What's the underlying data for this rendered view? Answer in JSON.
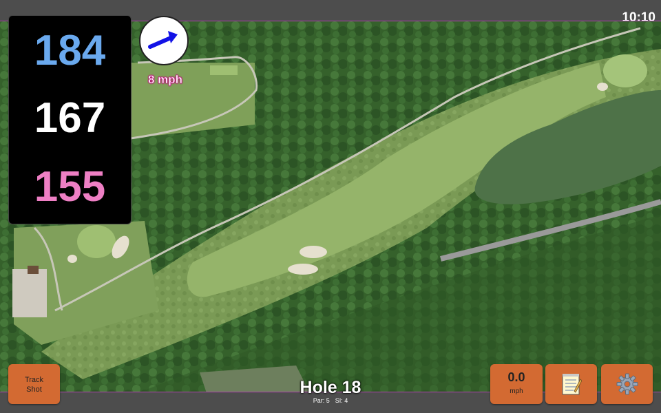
{
  "status_bar": {
    "time": "10:10"
  },
  "distances": {
    "back": "184",
    "middle": "167",
    "front": "155"
  },
  "wind": {
    "speed_label": "8 mph",
    "direction_icon": "wind-direction-arrow-icon"
  },
  "buttons": {
    "track_shot_line1": "Track",
    "track_shot_line2": "Shot",
    "speed_value": "0.0",
    "speed_unit": "mph",
    "notes_icon": "notepad-icon",
    "settings_icon": "gear-icon"
  },
  "hole": {
    "title": "Hole 18",
    "par": "Par: 5",
    "si": "SI: 4"
  },
  "colors": {
    "back_distance": "#6aa9ee",
    "middle_distance": "#ffffff",
    "front_distance": "#ee7fc4",
    "button_accent": "#d36a32",
    "wind_arrow": "#1212e6"
  }
}
